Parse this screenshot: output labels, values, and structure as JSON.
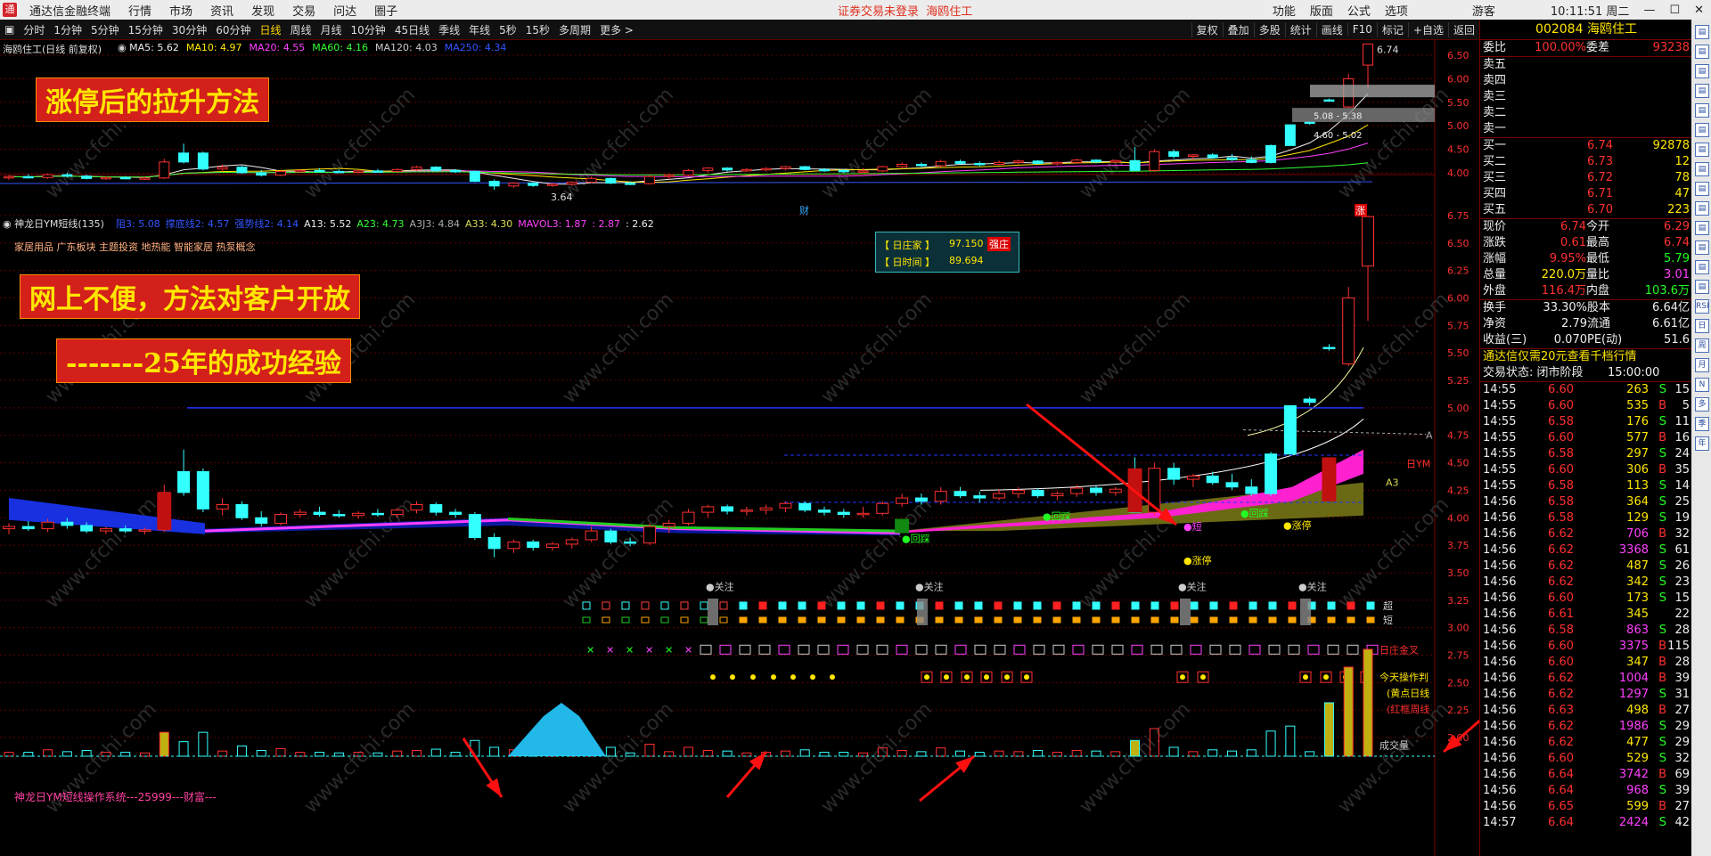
{
  "menubar": {
    "app_name": "通达信金融终端",
    "items": [
      "行情",
      "市场",
      "资讯",
      "发现",
      "交易",
      "问达",
      "圈子"
    ],
    "notice": "证券交易未登录",
    "notice_stock": "海鸥住工",
    "right": [
      "功能",
      "版面",
      "公式",
      "选项"
    ],
    "user": "游客",
    "time": "10:11:51 周二"
  },
  "toolbar": {
    "periods": [
      "分时",
      "1分钟",
      "5分钟",
      "15分钟",
      "30分钟",
      "60分钟",
      "日线",
      "周线",
      "月线",
      "10分钟",
      "45日线",
      "季线",
      "年线",
      "5秒",
      "15秒",
      "多周期",
      "更多 >"
    ],
    "active_period": "日线",
    "tools": [
      "复权",
      "叠加",
      "多股",
      "统计",
      "画线",
      "F10",
      "标记",
      "+自选",
      "返回"
    ]
  },
  "main_chart": {
    "title": "海鸥住工(日线 前复权)",
    "ma_items": [
      {
        "text": "MA5: 5.62",
        "color": "#eeeeee"
      },
      {
        "text": "MA10: 4.97",
        "color": "#ffe600"
      },
      {
        "text": "MA20: 4.55",
        "color": "#ff40ff"
      },
      {
        "text": "MA60: 4.16",
        "color": "#33ff33"
      },
      {
        "text": "MA120: 4.03",
        "color": "#cccccc"
      },
      {
        "text": "MA250: 4.34",
        "color": "#3355ff"
      }
    ],
    "y_ticks": [
      "6.50",
      "6.00",
      "5.50",
      "5.00",
      "4.50",
      "4.00"
    ],
    "high_label": "6.74",
    "low_label": "3.64",
    "box1": "5.08 - 5.38",
    "box2": "4.60 - 5.02",
    "marker_cai": "财",
    "marker_zhang": "涨"
  },
  "overlay1": "涨停后的拉升方法",
  "indicator": {
    "title": "神龙日YM短线(135)",
    "items": [
      {
        "text": "阻3: 5.08",
        "color": "#3355ff"
      },
      {
        "text": "撑底线2: 4.57",
        "color": "#3355ff"
      },
      {
        "text": "强势线2: 4.14",
        "color": "#3355ff"
      },
      {
        "text": "A13: 5.52",
        "color": "#eeeeee"
      },
      {
        "text": "A23: 4.73",
        "color": "#33ff33"
      },
      {
        "text": "A3J3: 4.84",
        "color": "#aaaaaa"
      },
      {
        "text": "A33: 4.30",
        "color": "#dddd55"
      },
      {
        "text": "MAVOL3: 1.87",
        "color": "#ff40ff"
      },
      {
        "text": ": 2.87",
        "color": "#ff40ff"
      },
      {
        "text": ": 2.62",
        "color": "#eeeeee"
      }
    ],
    "sectors": "家居用品 广东板块 主题投资 地热能 智能家居 热泵概念",
    "info_box": {
      "row1_label": "【 日庄家 】",
      "row1_value": "97.150",
      "row1_tag": "强庄",
      "row2_label": "【 日时间 】",
      "row2_value": "89.694"
    },
    "y_ticks": [
      "6.75",
      "6.50",
      "6.25",
      "6.00",
      "5.75",
      "5.50",
      "5.25",
      "5.00",
      "4.75",
      "4.50",
      "4.25",
      "4.00",
      "3.75",
      "3.50",
      "3.25",
      "3.00",
      "2.75",
      "2.50",
      "2.25",
      "2.00"
    ],
    "labels": {
      "huicai1": "●回踩",
      "huicai2": "●回踩",
      "huicai3": "●回踩",
      "duan": "●短",
      "zhangting1": "●涨停",
      "zhangting2": "●涨停",
      "guanzhu": "●关注",
      "A": "A",
      "A3": "A3",
      "riym": "日YM",
      "chao": "超",
      "duan2": "短",
      "jincha": "日庄金叉",
      "today": "今天操作判",
      "dot_desc": "(黄点日线",
      "red_desc": "(红框周线",
      "volume": "成交量"
    },
    "system_name": "神龙日YM短线操作系统---25999---财富---"
  },
  "overlay2": "网上不便，方法对客户开放",
  "overlay3": "-------25年的成功经验",
  "right_panel": {
    "code": "002084",
    "name": "海鸥住工",
    "webi": {
      "label": "委比",
      "value": "100.00%",
      "label2": "委差",
      "value2": "93238"
    },
    "sells": [
      {
        "l": "卖五",
        "p": "",
        "v": ""
      },
      {
        "l": "卖四",
        "p": "",
        "v": ""
      },
      {
        "l": "卖三",
        "p": "",
        "v": ""
      },
      {
        "l": "卖二",
        "p": "",
        "v": ""
      },
      {
        "l": "卖一",
        "p": "",
        "v": ""
      }
    ],
    "buys": [
      {
        "l": "买一",
        "p": "6.74",
        "v": "92878"
      },
      {
        "l": "买二",
        "p": "6.73",
        "v": "12"
      },
      {
        "l": "买三",
        "p": "6.72",
        "v": "78"
      },
      {
        "l": "买四",
        "p": "6.71",
        "v": "47"
      },
      {
        "l": "买五",
        "p": "6.70",
        "v": "223"
      }
    ],
    "quotes": [
      {
        "l1": "现价",
        "v1": "6.74",
        "l2": "今开",
        "v2": "6.29"
      },
      {
        "l1": "涨跌",
        "v1": "0.61",
        "l2": "最高",
        "v2": "6.74"
      },
      {
        "l1": "涨幅",
        "v1": "9.95%",
        "l2": "最低",
        "v2": "5.79"
      },
      {
        "l1": "总量",
        "v1": "220.0万",
        "l2": "量比",
        "v2": "3.01"
      },
      {
        "l1": "外盘",
        "v1": "116.4万",
        "l2": "内盘",
        "v2": "103.6万"
      }
    ],
    "stats": [
      {
        "l1": "换手",
        "v1": "33.30%",
        "l2": "股本",
        "v2": "6.64亿"
      },
      {
        "l1": "净资",
        "v1": "2.79",
        "l2": "流通",
        "v2": "6.61亿"
      },
      {
        "l1": "收益(三)",
        "v1": "0.070",
        "l2": "PE(动)",
        "v2": "51.6"
      }
    ],
    "ad": "通达信仅需20元查看千档行情",
    "state_label": "交易状态: 闭市阶段",
    "state_time": "15:00:00",
    "ticks": [
      [
        "14:55",
        "6.60",
        "263",
        "S",
        "15"
      ],
      [
        "14:55",
        "6.60",
        "535",
        "B",
        "5"
      ],
      [
        "14:55",
        "6.58",
        "176",
        "S",
        "11"
      ],
      [
        "14:55",
        "6.60",
        "577",
        "B",
        "16"
      ],
      [
        "14:55",
        "6.58",
        "297",
        "S",
        "24"
      ],
      [
        "14:55",
        "6.60",
        "306",
        "B",
        "35"
      ],
      [
        "14:55",
        "6.58",
        "113",
        "S",
        "14"
      ],
      [
        "14:56",
        "6.58",
        "364",
        "S",
        "25"
      ],
      [
        "14:56",
        "6.58",
        "129",
        "S",
        "19"
      ],
      [
        "14:56",
        "6.62",
        "706",
        "B",
        "32"
      ],
      [
        "14:56",
        "6.62",
        "3368",
        "S",
        "61"
      ],
      [
        "14:56",
        "6.62",
        "487",
        "S",
        "26"
      ],
      [
        "14:56",
        "6.62",
        "342",
        "S",
        "23"
      ],
      [
        "14:56",
        "6.60",
        "173",
        "S",
        "15"
      ],
      [
        "14:56",
        "6.61",
        "345",
        "",
        "22"
      ],
      [
        "14:56",
        "6.58",
        "863",
        "S",
        "28"
      ],
      [
        "14:56",
        "6.60",
        "3375",
        "B",
        "115"
      ],
      [
        "14:56",
        "6.60",
        "347",
        "B",
        "28"
      ],
      [
        "14:56",
        "6.62",
        "1004",
        "B",
        "39"
      ],
      [
        "14:56",
        "6.62",
        "1297",
        "S",
        "31"
      ],
      [
        "14:56",
        "6.63",
        "498",
        "B",
        "27"
      ],
      [
        "14:56",
        "6.62",
        "1986",
        "S",
        "29"
      ],
      [
        "14:56",
        "6.62",
        "477",
        "S",
        "29"
      ],
      [
        "14:56",
        "6.60",
        "529",
        "S",
        "32"
      ],
      [
        "14:56",
        "6.64",
        "3742",
        "B",
        "69"
      ],
      [
        "14:56",
        "6.64",
        "968",
        "S",
        "39"
      ],
      [
        "14:56",
        "6.65",
        "599",
        "B",
        "27"
      ],
      [
        "14:57",
        "6.64",
        "2424",
        "S",
        "42"
      ]
    ]
  },
  "right_sidebar": [
    "RSI",
    "日",
    "周",
    "月",
    "N",
    "多",
    "季",
    "年"
  ],
  "watermark": "www.cfchi.com",
  "chart_data": {
    "type": "candlestick",
    "title": "海鸥住工(日线 前复权)",
    "ylim_main": [
      3.6,
      6.8
    ],
    "notable": {
      "high": 6.74,
      "low": 3.64
    },
    "candles": [
      {
        "o": 3.9,
        "h": 3.95,
        "l": 3.85,
        "c": 3.92,
        "up": true
      },
      {
        "o": 3.92,
        "h": 3.97,
        "l": 3.88,
        "c": 3.9,
        "up": false
      },
      {
        "o": 3.9,
        "h": 3.99,
        "l": 3.87,
        "c": 3.96,
        "up": true
      },
      {
        "o": 3.96,
        "h": 4.0,
        "l": 3.9,
        "c": 3.93,
        "up": false
      },
      {
        "o": 3.93,
        "h": 3.96,
        "l": 3.86,
        "c": 3.88,
        "up": false
      },
      {
        "o": 3.88,
        "h": 3.92,
        "l": 3.85,
        "c": 3.9,
        "up": true
      },
      {
        "o": 3.9,
        "h": 3.93,
        "l": 3.86,
        "c": 3.88,
        "up": false
      },
      {
        "o": 3.88,
        "h": 3.91,
        "l": 3.85,
        "c": 3.89,
        "up": true
      },
      {
        "o": 3.89,
        "h": 4.3,
        "l": 3.87,
        "c": 4.23,
        "up": true
      },
      {
        "o": 4.23,
        "h": 4.62,
        "l": 4.2,
        "c": 4.42,
        "up": false
      },
      {
        "o": 4.42,
        "h": 4.45,
        "l": 4.05,
        "c": 4.08,
        "up": false
      },
      {
        "o": 4.08,
        "h": 4.18,
        "l": 4.02,
        "c": 4.12,
        "up": true
      },
      {
        "o": 4.12,
        "h": 4.15,
        "l": 3.98,
        "c": 4.0,
        "up": false
      },
      {
        "o": 4.0,
        "h": 4.06,
        "l": 3.92,
        "c": 3.95,
        "up": false
      },
      {
        "o": 3.95,
        "h": 4.05,
        "l": 3.93,
        "c": 4.03,
        "up": true
      },
      {
        "o": 4.03,
        "h": 4.08,
        "l": 4.0,
        "c": 4.05,
        "up": true
      },
      {
        "o": 4.05,
        "h": 4.1,
        "l": 4.01,
        "c": 4.03,
        "up": false
      },
      {
        "o": 4.03,
        "h": 4.07,
        "l": 4.0,
        "c": 4.02,
        "up": false
      },
      {
        "o": 4.02,
        "h": 4.06,
        "l": 3.99,
        "c": 4.04,
        "up": true
      },
      {
        "o": 4.04,
        "h": 4.08,
        "l": 4.01,
        "c": 4.03,
        "up": false
      },
      {
        "o": 4.03,
        "h": 4.09,
        "l": 4.0,
        "c": 4.07,
        "up": true
      },
      {
        "o": 4.07,
        "h": 4.15,
        "l": 4.04,
        "c": 4.12,
        "up": true
      },
      {
        "o": 4.12,
        "h": 4.14,
        "l": 4.02,
        "c": 4.05,
        "up": false
      },
      {
        "o": 4.05,
        "h": 4.08,
        "l": 4.0,
        "c": 4.03,
        "up": false
      },
      {
        "o": 4.03,
        "h": 4.05,
        "l": 3.8,
        "c": 3.82,
        "up": false
      },
      {
        "o": 3.82,
        "h": 3.86,
        "l": 3.64,
        "c": 3.72,
        "up": false
      },
      {
        "o": 3.72,
        "h": 3.8,
        "l": 3.68,
        "c": 3.78,
        "up": true
      },
      {
        "o": 3.78,
        "h": 3.8,
        "l": 3.7,
        "c": 3.73,
        "up": false
      },
      {
        "o": 3.73,
        "h": 3.78,
        "l": 3.7,
        "c": 3.76,
        "up": true
      },
      {
        "o": 3.76,
        "h": 3.82,
        "l": 3.72,
        "c": 3.8,
        "up": true
      },
      {
        "o": 3.8,
        "h": 3.92,
        "l": 3.78,
        "c": 3.88,
        "up": true
      },
      {
        "o": 3.88,
        "h": 3.9,
        "l": 3.76,
        "c": 3.78,
        "up": false
      },
      {
        "o": 3.78,
        "h": 3.82,
        "l": 3.74,
        "c": 3.77,
        "up": false
      },
      {
        "o": 3.77,
        "h": 3.95,
        "l": 3.75,
        "c": 3.92,
        "up": true
      },
      {
        "o": 3.92,
        "h": 3.98,
        "l": 3.86,
        "c": 3.95,
        "up": true
      },
      {
        "o": 3.95,
        "h": 4.08,
        "l": 3.93,
        "c": 4.05,
        "up": true
      },
      {
        "o": 4.05,
        "h": 4.12,
        "l": 4.0,
        "c": 4.1,
        "up": true
      },
      {
        "o": 4.1,
        "h": 4.12,
        "l": 4.03,
        "c": 4.06,
        "up": false
      },
      {
        "o": 4.06,
        "h": 4.1,
        "l": 4.02,
        "c": 4.07,
        "up": true
      },
      {
        "o": 4.07,
        "h": 4.12,
        "l": 4.03,
        "c": 4.09,
        "up": true
      },
      {
        "o": 4.09,
        "h": 4.15,
        "l": 4.05,
        "c": 4.13,
        "up": true
      },
      {
        "o": 4.13,
        "h": 4.15,
        "l": 4.05,
        "c": 4.07,
        "up": false
      },
      {
        "o": 4.07,
        "h": 4.1,
        "l": 4.02,
        "c": 4.05,
        "up": false
      },
      {
        "o": 4.05,
        "h": 4.08,
        "l": 4.0,
        "c": 4.03,
        "up": false
      },
      {
        "o": 4.03,
        "h": 4.1,
        "l": 4.0,
        "c": 4.04,
        "up": true
      },
      {
        "o": 4.04,
        "h": 4.15,
        "l": 4.02,
        "c": 4.13,
        "up": true
      },
      {
        "o": 4.13,
        "h": 4.22,
        "l": 4.1,
        "c": 4.18,
        "up": true
      },
      {
        "o": 4.18,
        "h": 4.22,
        "l": 4.12,
        "c": 4.15,
        "up": false
      },
      {
        "o": 4.15,
        "h": 4.28,
        "l": 4.12,
        "c": 4.24,
        "up": true
      },
      {
        "o": 4.24,
        "h": 4.28,
        "l": 4.18,
        "c": 4.2,
        "up": false
      },
      {
        "o": 4.2,
        "h": 4.24,
        "l": 4.14,
        "c": 4.18,
        "up": false
      },
      {
        "o": 4.18,
        "h": 4.26,
        "l": 4.16,
        "c": 4.22,
        "up": true
      },
      {
        "o": 4.22,
        "h": 4.28,
        "l": 4.18,
        "c": 4.25,
        "up": true
      },
      {
        "o": 4.25,
        "h": 4.27,
        "l": 4.18,
        "c": 4.2,
        "up": false
      },
      {
        "o": 4.2,
        "h": 4.24,
        "l": 4.16,
        "c": 4.22,
        "up": true
      },
      {
        "o": 4.22,
        "h": 4.3,
        "l": 4.19,
        "c": 4.27,
        "up": true
      },
      {
        "o": 4.27,
        "h": 4.29,
        "l": 4.2,
        "c": 4.23,
        "up": false
      },
      {
        "o": 4.23,
        "h": 4.28,
        "l": 4.2,
        "c": 4.26,
        "up": true
      },
      {
        "o": 4.26,
        "h": 4.55,
        "l": 4.05,
        "c": 4.05,
        "up": false
      },
      {
        "o": 4.05,
        "h": 4.5,
        "l": 4.02,
        "c": 4.45,
        "up": true
      },
      {
        "o": 4.45,
        "h": 4.5,
        "l": 4.3,
        "c": 4.35,
        "up": false
      },
      {
        "o": 4.35,
        "h": 4.4,
        "l": 4.28,
        "c": 4.38,
        "up": true
      },
      {
        "o": 4.38,
        "h": 4.42,
        "l": 4.3,
        "c": 4.32,
        "up": false
      },
      {
        "o": 4.32,
        "h": 4.4,
        "l": 4.25,
        "c": 4.28,
        "up": false
      },
      {
        "o": 4.28,
        "h": 4.35,
        "l": 4.2,
        "c": 4.22,
        "up": false
      },
      {
        "o": 4.22,
        "h": 4.6,
        "l": 4.2,
        "c": 4.58,
        "up": false
      },
      {
        "o": 4.58,
        "h": 5.02,
        "l": 4.58,
        "c": 5.02,
        "up": false
      },
      {
        "o": 5.05,
        "h": 5.1,
        "l": 5.02,
        "c": 5.08,
        "up": false
      },
      {
        "o": 5.55,
        "h": 5.58,
        "l": 5.52,
        "c": 5.55,
        "up": false
      },
      {
        "o": 5.4,
        "h": 6.1,
        "l": 5.38,
        "c": 6.0,
        "up": true
      },
      {
        "o": 6.29,
        "h": 6.74,
        "l": 5.79,
        "c": 6.74,
        "up": true
      }
    ]
  }
}
